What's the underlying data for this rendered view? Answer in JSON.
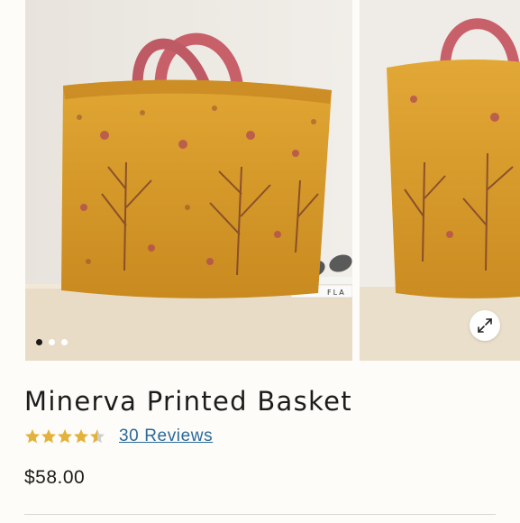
{
  "product": {
    "title": "Minerva Printed Basket",
    "rating": 4.5,
    "rating_max": 5,
    "reviews_label": "30 Reviews",
    "price": "$58.00"
  },
  "gallery": {
    "slide_count": 3,
    "active_index": 0,
    "book_spine_text": "FLA"
  },
  "colors": {
    "star": "#e3b23c",
    "star_empty": "#cfcfcf",
    "link": "#2b6a9a",
    "basket": "#d89a27",
    "handle": "#c8606a"
  },
  "icons": {
    "expand": "expand-arrows-icon",
    "star": "star-icon"
  }
}
